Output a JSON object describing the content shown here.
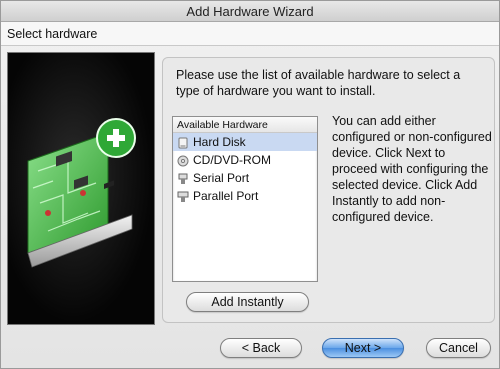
{
  "window": {
    "title": "Add Hardware Wizard"
  },
  "header": {
    "title": "Select hardware"
  },
  "intro": "Please use the list of available hardware to select a type of hardware you want to install.",
  "hardware_list": {
    "header": "Available Hardware",
    "items": [
      {
        "label": "Hard Disk",
        "icon": "hard-disk-icon",
        "selected": true
      },
      {
        "label": "CD/DVD-ROM",
        "icon": "cd-dvd-icon",
        "selected": false
      },
      {
        "label": "Serial Port",
        "icon": "serial-port-icon",
        "selected": false
      },
      {
        "label": "Parallel Port",
        "icon": "parallel-port-icon",
        "selected": false
      }
    ]
  },
  "description": "You can add either configured or non-configured device. Click Next to proceed with configuring the selected device. Click Add Instantly to add non-configured device.",
  "buttons": {
    "add_instantly": "Add Instantly",
    "back": "< Back",
    "next": "Next >",
    "cancel": "Cancel"
  },
  "colors": {
    "selection": "#c9d9f2",
    "default_button": "#4b8fe0",
    "plus_badge": "#2fa836",
    "board": "#4cc34c"
  }
}
